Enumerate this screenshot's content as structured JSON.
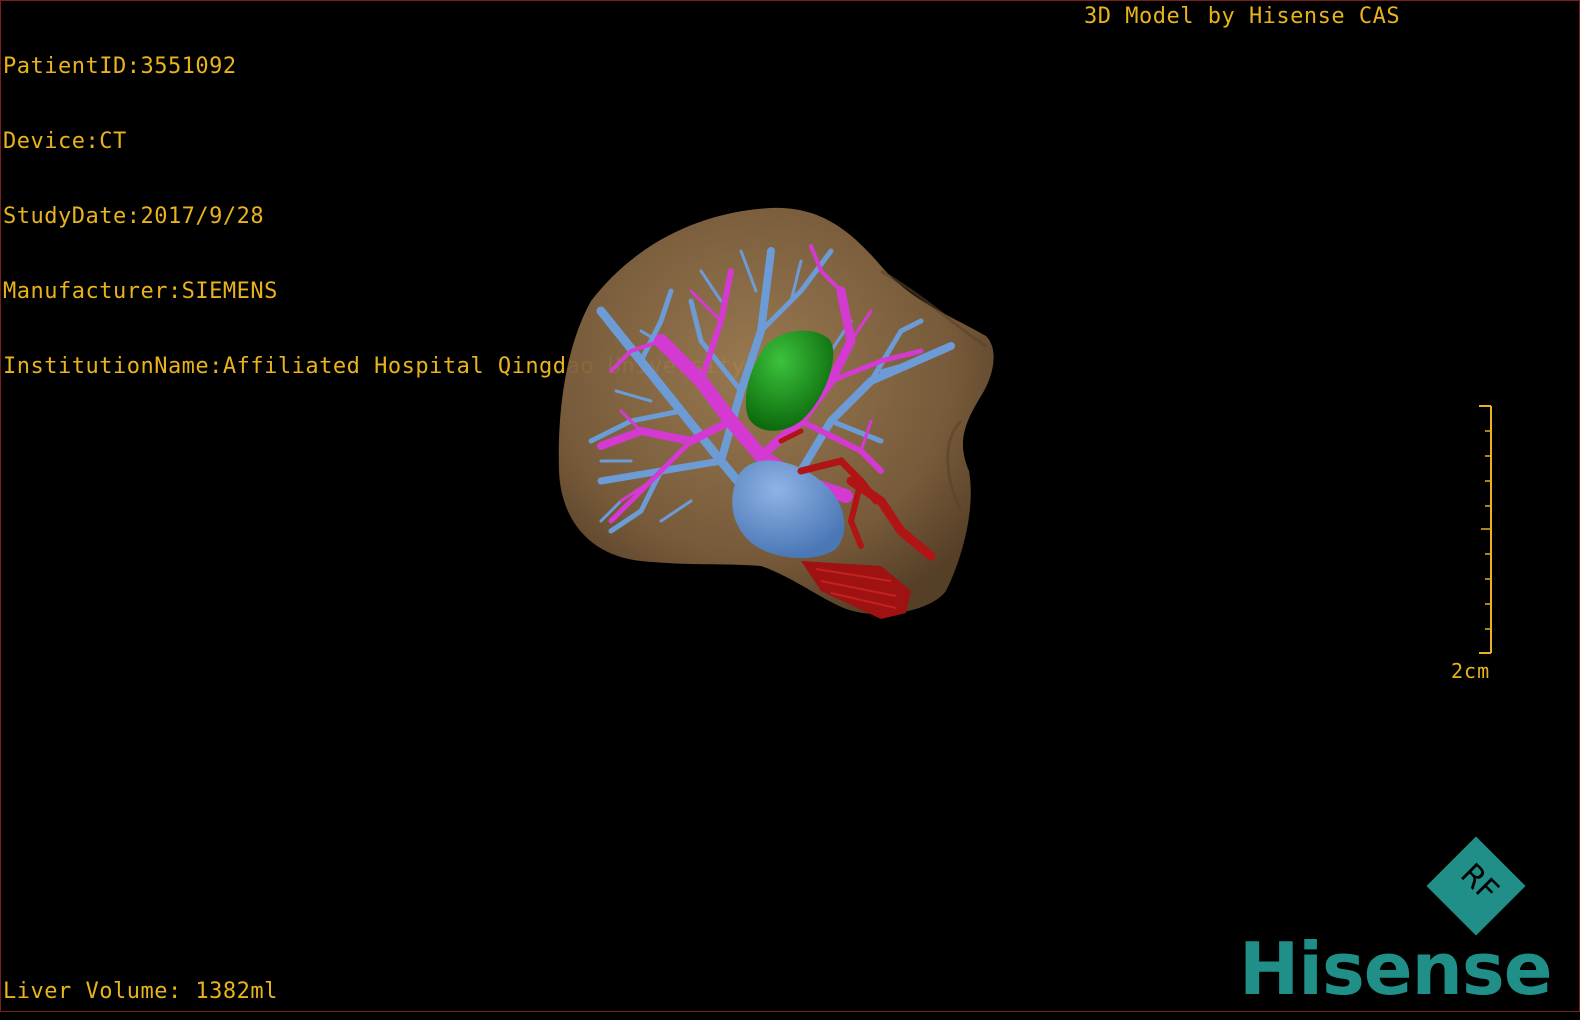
{
  "patient_info": {
    "patient_id": "PatientID:3551092",
    "device": "Device:CT",
    "study_date": "StudyDate:2017/9/28",
    "manufacturer": "Manufacturer:SIEMENS",
    "institution": "InstitutionName:Affiliated Hospital Qingdao University-C"
  },
  "watermark": "3D Model by Hisense CAS",
  "liver_volume": "Liver Volume: 1382ml",
  "scale": {
    "label": "2cm"
  },
  "logo": {
    "badge_letters": "RF",
    "brand": "Hisense",
    "brand_color": "#1f8f88"
  },
  "colors": {
    "text": "#e8b31c",
    "liver": "#8a6a44",
    "hepatic_vein": "#6c9bd6",
    "portal_vein": "#d43ad2",
    "gallbladder": "#1f8f1f",
    "artery": "#b01414",
    "background": "#000000"
  }
}
